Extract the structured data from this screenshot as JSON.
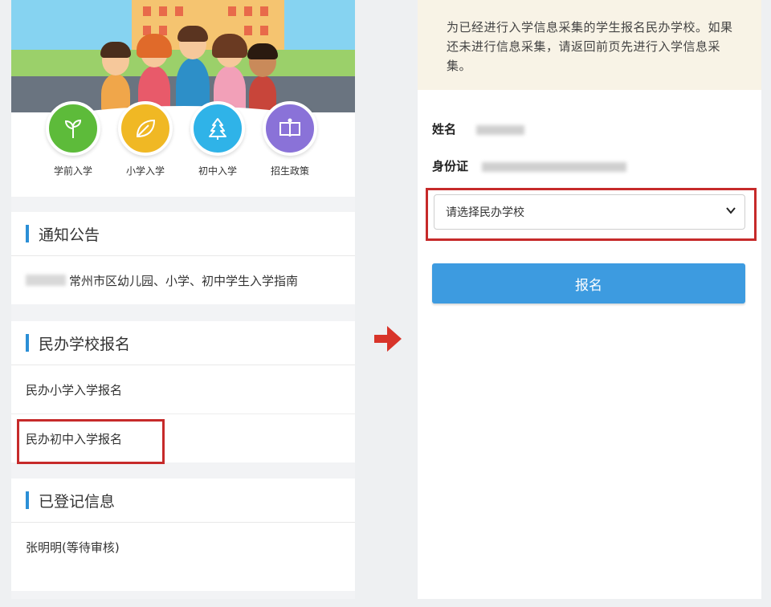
{
  "categories": [
    {
      "label": "学前入学",
      "icon": "sprout-icon",
      "color": "#5dbb3a"
    },
    {
      "label": "小学入学",
      "icon": "leaf-icon",
      "color": "#f0b824"
    },
    {
      "label": "初中入学",
      "icon": "tree-icon",
      "color": "#2fb3e8"
    },
    {
      "label": "招生政策",
      "icon": "book-icon",
      "color": "#8a72d8"
    }
  ],
  "notices": {
    "title": "通知公告",
    "items": [
      {
        "text": "常州市区幼儿园、小学、初中学生入学指南"
      }
    ]
  },
  "private_school": {
    "title": "民办学校报名",
    "items": [
      {
        "label": "民办小学入学报名"
      },
      {
        "label": "民办初中入学报名"
      }
    ]
  },
  "registered": {
    "title": "已登记信息",
    "items": [
      {
        "label": "张明明(等待审核)"
      }
    ]
  },
  "form": {
    "notice": "为已经进行入学信息采集的学生报名民办学校。如果还未进行信息采集，请返回前页先进行入学信息采集。",
    "name_label": "姓名",
    "id_label": "身份证",
    "school_select": {
      "value": "请选择民办学校"
    },
    "submit_label": "报名"
  },
  "colors": {
    "accent": "#2b8fd6",
    "button": "#3d9be0",
    "highlight": "#c62a2a",
    "arrow": "#d8342a"
  }
}
